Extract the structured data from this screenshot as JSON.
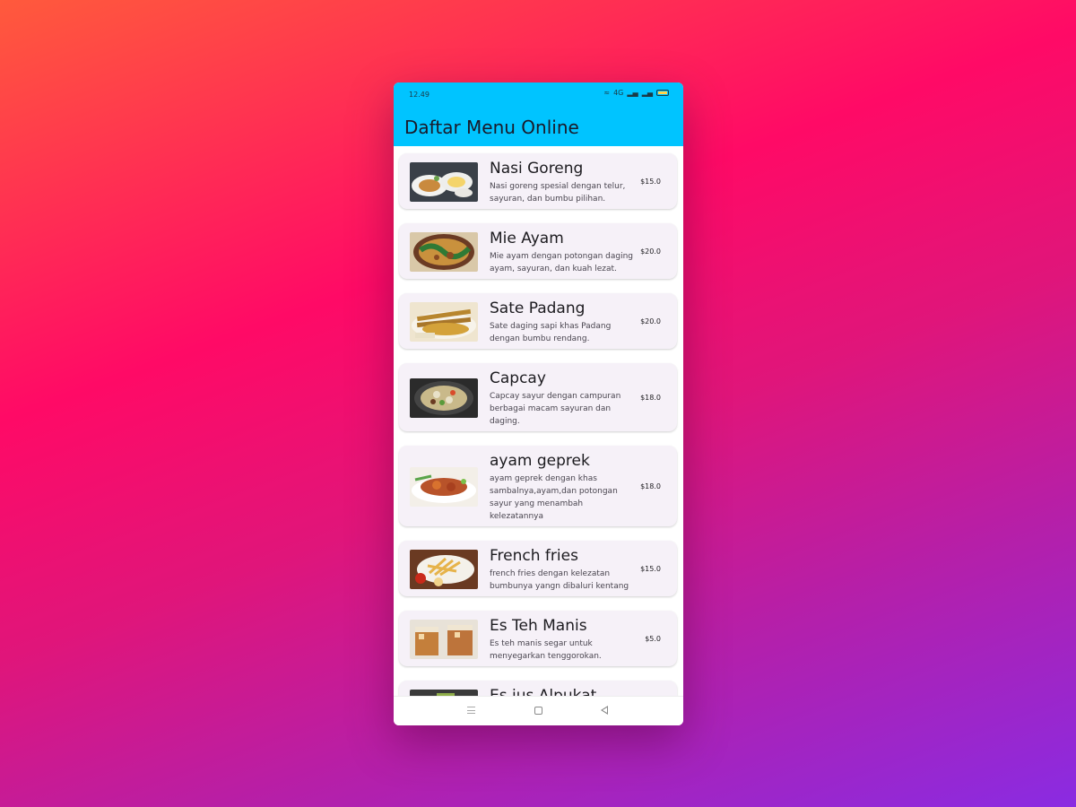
{
  "status": {
    "time": "12.49",
    "network": "4G"
  },
  "appbar": {
    "title": "Daftar Menu Online"
  },
  "menu": [
    {
      "name": "Nasi Goreng",
      "desc": "Nasi goreng spesial dengan telur, sayuran, dan bumbu pilihan.",
      "price": "$15.0",
      "photo": "nasi-goreng-photo"
    },
    {
      "name": "Mie Ayam",
      "desc": "Mie ayam dengan potongan daging ayam, sayuran, dan kuah lezat.",
      "price": "$20.0",
      "photo": "mie-ayam-photo"
    },
    {
      "name": "Sate Padang",
      "desc": "Sate daging sapi khas Padang dengan bumbu rendang.",
      "price": "$20.0",
      "photo": "sate-padang-photo"
    },
    {
      "name": "Capcay",
      "desc": "Capcay sayur dengan campuran berbagai macam sayuran dan daging.",
      "price": "$18.0",
      "photo": "capcay-photo"
    },
    {
      "name": "ayam geprek",
      "desc": "ayam geprek dengan khas sambalnya,ayam,dan potongan sayur yang menambah kelezatannya",
      "price": "$18.0",
      "photo": "ayam-geprek-photo"
    },
    {
      "name": "French fries",
      "desc": "french fries dengan kelezatan bumbunya yangn dibaluri kentang",
      "price": "$15.0",
      "photo": "french-fries-photo"
    },
    {
      "name": "Es Teh Manis",
      "desc": "Es teh manis segar untuk menyegarkan tenggorokan.",
      "price": "$5.0",
      "photo": "es-teh-manis-photo"
    },
    {
      "name": "Es jus Alpukat",
      "desc": "",
      "price": "",
      "photo": "es-jus-alpukat-photo"
    }
  ],
  "colors": {
    "appbar": "#00c4ff",
    "card": "#f6f1f8"
  }
}
